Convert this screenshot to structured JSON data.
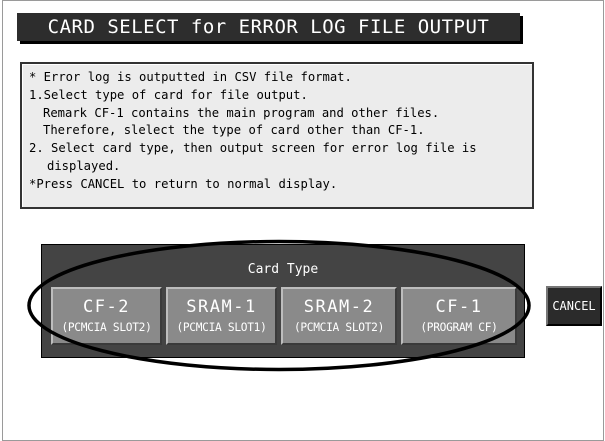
{
  "title": "CARD SELECT for ERROR LOG FILE OUTPUT",
  "info": {
    "lines": [
      "* Error log is outputted in CSV file format.",
      "1.Select type of card for file output.",
      "Remark CF-1 contains the main program and other files.",
      "Therefore, slelect the type of card other than CF-1.",
      "2. Select card type, then output screen for error log file is",
      "displayed.",
      "*Press CANCEL to return to normal display."
    ]
  },
  "card_panel": {
    "title": "Card Type",
    "buttons": [
      {
        "name": "CF-2",
        "sub": "(PCMCIA SLOT2)"
      },
      {
        "name": "SRAM-1",
        "sub": "(PCMCIA SLOT1)"
      },
      {
        "name": "SRAM-2",
        "sub": "(PCMCIA SLOT2)"
      },
      {
        "name": "CF-1",
        "sub": "(PROGRAM CF)"
      }
    ]
  },
  "cancel_label": "CANCEL",
  "colors": {
    "title_bg": "#2d2d2d",
    "info_bg": "#ececec",
    "panel_bg": "#444444",
    "card_button_bg": "#8a8a8a",
    "cancel_bg": "#2b2b2b"
  }
}
